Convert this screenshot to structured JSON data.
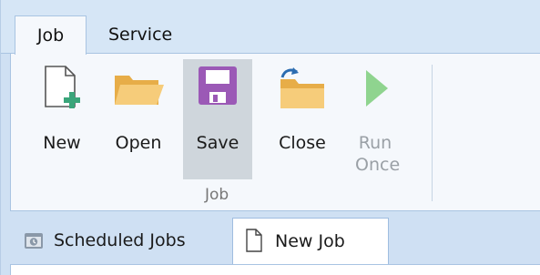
{
  "ribbon": {
    "tabs": [
      {
        "label": "Job",
        "active": true
      },
      {
        "label": "Service",
        "active": false
      }
    ],
    "group_label": "Job",
    "buttons": [
      {
        "label": "New",
        "icon": "new-document-icon",
        "enabled": true
      },
      {
        "label": "Open",
        "icon": "folder-open-icon",
        "enabled": true
      },
      {
        "label": "Save",
        "icon": "save-disk-icon",
        "enabled": true,
        "highlighted": true
      },
      {
        "label": "Close",
        "icon": "folder-close-icon",
        "enabled": true
      },
      {
        "label": "Run Once",
        "icon": "play-icon",
        "enabled": false
      }
    ]
  },
  "document_tabs": [
    {
      "label": "Scheduled Jobs",
      "icon": "scheduled-jobs-icon",
      "active": false
    },
    {
      "label": "New Job",
      "icon": "document-icon",
      "active": true
    }
  ],
  "colors": {
    "ribbon_bg": "#f5f8fc",
    "frame_bg": "#cfe0f3",
    "hover_bg": "#cfd6dc",
    "save_icon": "#9b59b6",
    "folder_icon": "#f3c56a",
    "play_icon": "#8fd48f",
    "new_plus": "#3aa57a"
  }
}
